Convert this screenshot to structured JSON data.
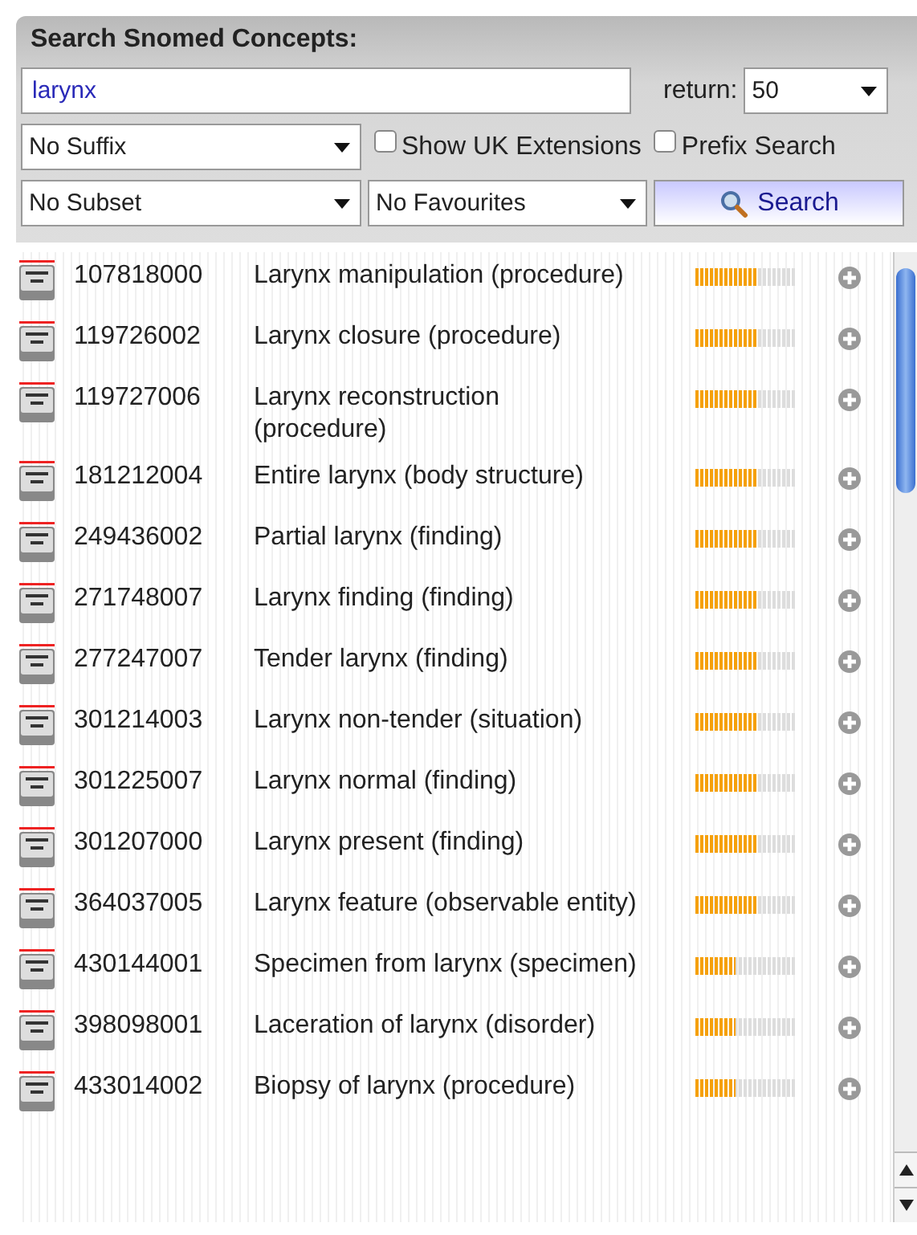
{
  "panel": {
    "title": "Search Snomed Concepts:",
    "query": "larynx",
    "return_label": "return:",
    "return_value": "50",
    "suffix": "No Suffix",
    "options": [
      {
        "label": "Show UK Extensions",
        "checked": false
      },
      {
        "label": "Prefix Search",
        "checked": false
      }
    ],
    "subset": "No Subset",
    "favourites": "No Favourites",
    "search_button": "Search"
  },
  "results": [
    {
      "code": "107818000",
      "term": "Larynx manipulation (procedure)",
      "level": 0.63
    },
    {
      "code": "119726002",
      "term": "Larynx closure (procedure)",
      "level": 0.63
    },
    {
      "code": "119727006",
      "term": "Larynx reconstruction (procedure)",
      "level": 0.63
    },
    {
      "code": "181212004",
      "term": "Entire larynx (body structure)",
      "level": 0.63
    },
    {
      "code": "249436002",
      "term": "Partial larynx (finding)",
      "level": 0.63
    },
    {
      "code": "271748007",
      "term": "Larynx finding (finding)",
      "level": 0.63
    },
    {
      "code": "277247007",
      "term": "Tender larynx (finding)",
      "level": 0.63
    },
    {
      "code": "301214003",
      "term": "Larynx non-tender (situation)",
      "level": 0.63
    },
    {
      "code": "301225007",
      "term": "Larynx normal (finding)",
      "level": 0.63
    },
    {
      "code": "301207000",
      "term": "Larynx present (finding)",
      "level": 0.63
    },
    {
      "code": "364037005",
      "term": "Larynx feature (observable entity)",
      "level": 0.63
    },
    {
      "code": "430144001",
      "term": "Specimen from larynx (specimen)",
      "level": 0.4
    },
    {
      "code": "398098001",
      "term": "Laceration of larynx (disorder)",
      "level": 0.4
    },
    {
      "code": "433014002",
      "term": "Biopsy of larynx (procedure)",
      "level": 0.4
    }
  ]
}
